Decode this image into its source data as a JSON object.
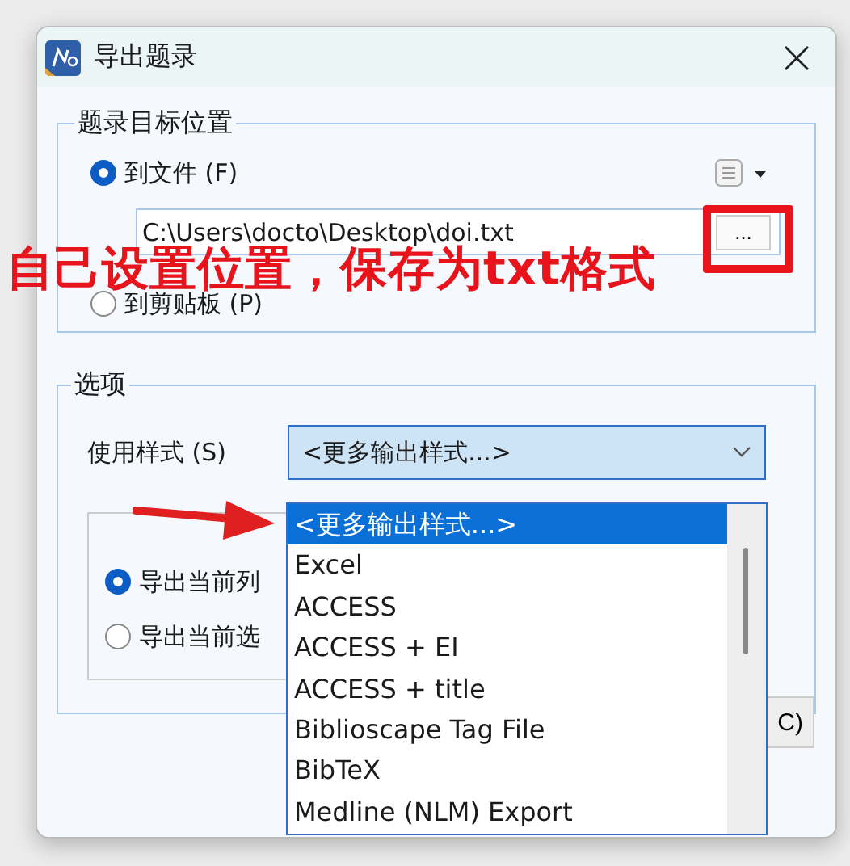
{
  "window": {
    "title": "导出题录"
  },
  "destination": {
    "legend": "题录目标位置",
    "options": [
      {
        "label": "到文件 (F)",
        "selected": true
      },
      {
        "label": "到剪贴板 (P)",
        "selected": false
      }
    ],
    "path": "C:\\Users\\docto\\Desktop\\doi.txt",
    "browse": "..."
  },
  "options_group": {
    "legend": "选项",
    "style_label": "使用样式 (S)",
    "style_value": "<更多输出样式...>",
    "scope": [
      {
        "label": "导出当前列",
        "selected": true
      },
      {
        "label": "导出当前选",
        "selected": false
      }
    ],
    "button_partial": "C)"
  },
  "dropdown": {
    "items": [
      {
        "label": "<更多输出样式...>",
        "selected": true
      },
      {
        "label": "Excel",
        "selected": false
      },
      {
        "label": "ACCESS",
        "selected": false
      },
      {
        "label": "ACCESS + EI",
        "selected": false
      },
      {
        "label": "ACCESS + title",
        "selected": false
      },
      {
        "label": "Biblioscape Tag File",
        "selected": false
      },
      {
        "label": "BibTeX",
        "selected": false
      },
      {
        "label": "Medline (NLM) Export",
        "selected": false
      }
    ]
  },
  "annotation": {
    "text": "自己设置位置，保存为txt格式"
  }
}
